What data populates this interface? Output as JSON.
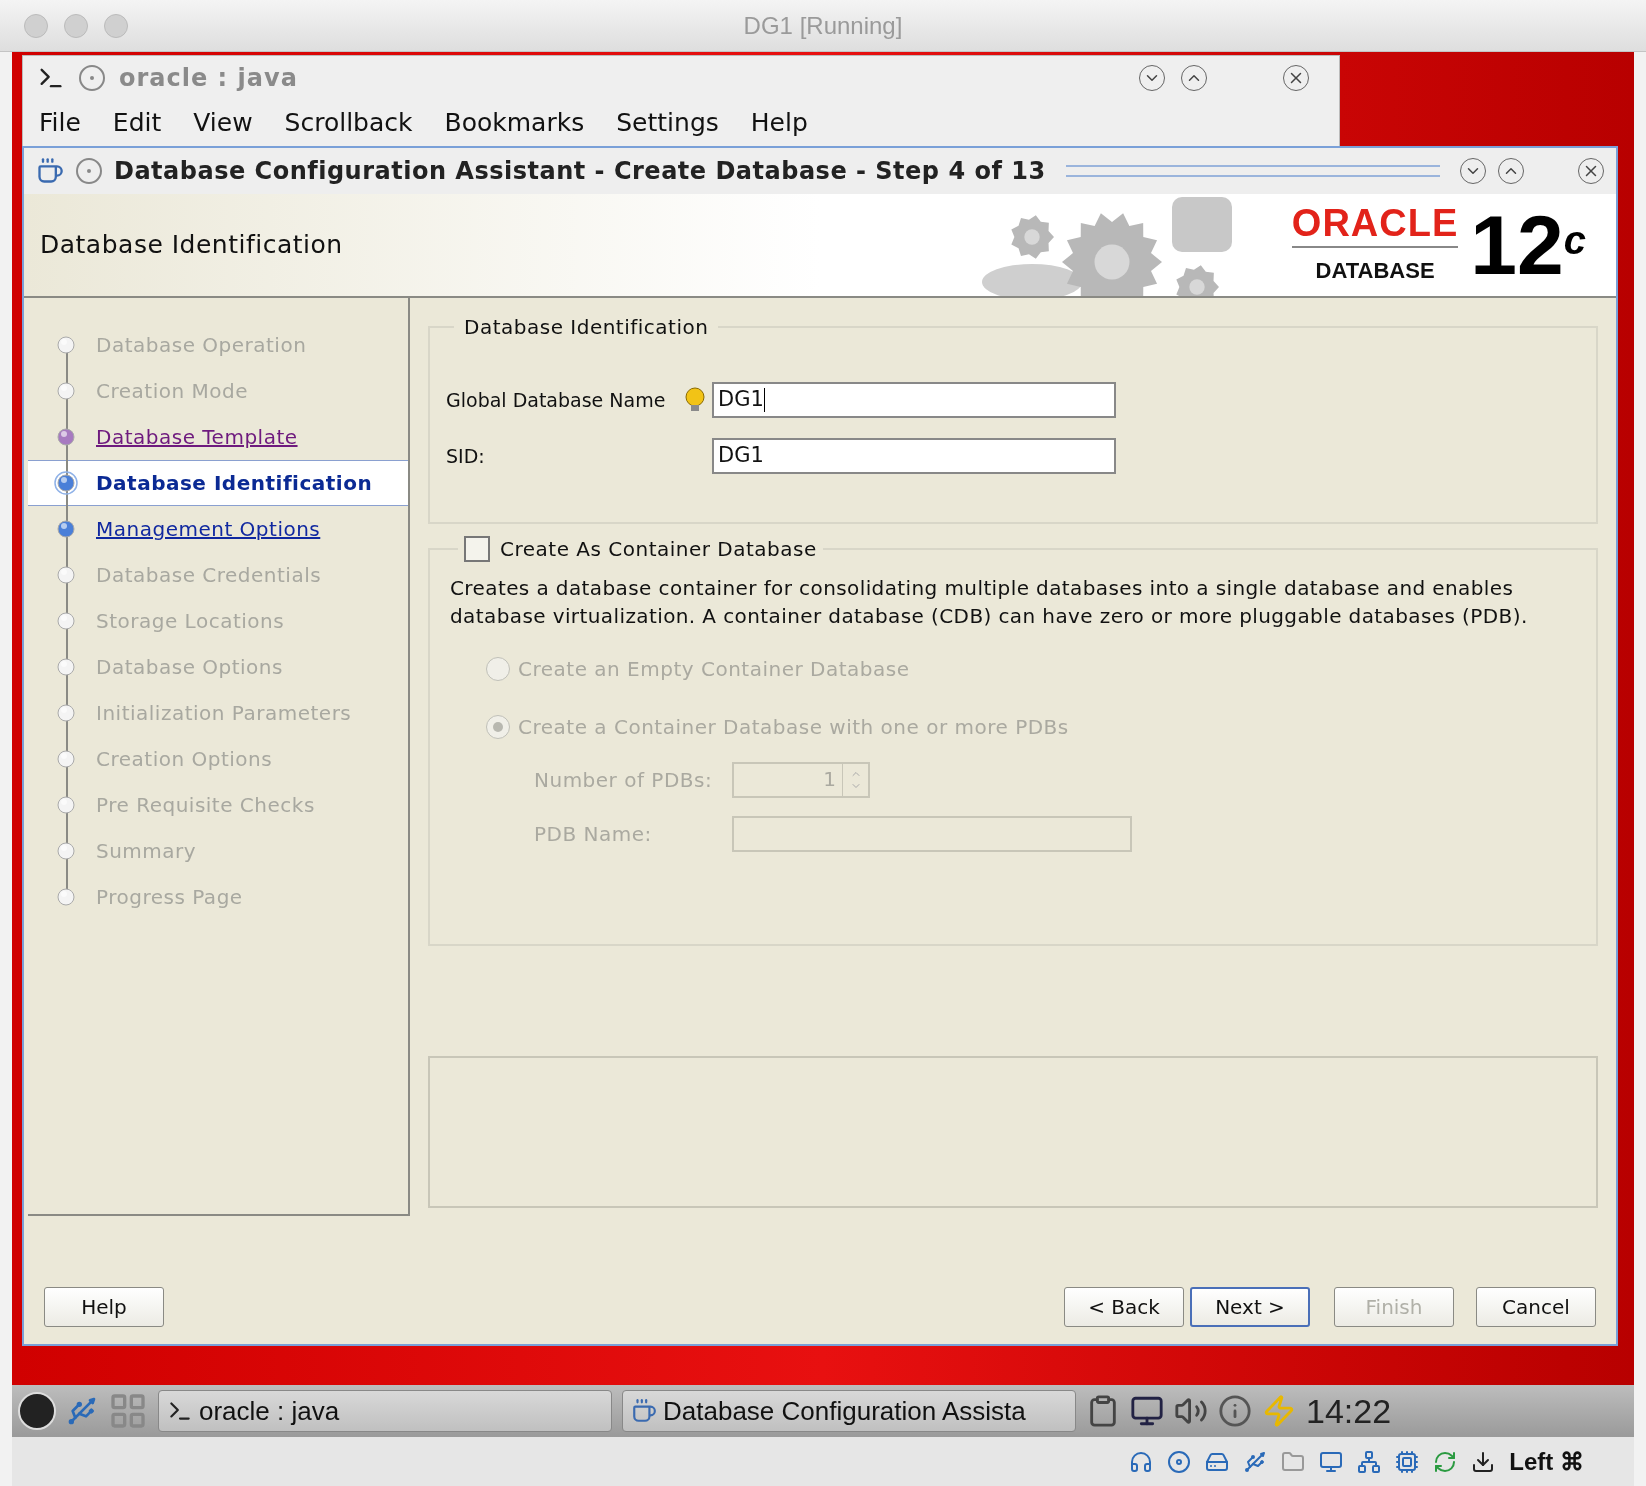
{
  "vm_window": {
    "title": "DG1 [Running]"
  },
  "terminal": {
    "title": "oracle : java",
    "menu": [
      "File",
      "Edit",
      "View",
      "Scrollback",
      "Bookmarks",
      "Settings",
      "Help"
    ]
  },
  "dialog": {
    "title": "Database Configuration Assistant - Create Database - Step 4 of 13",
    "page_title": "Database Identification",
    "logo": {
      "brand": "ORACLE",
      "product": "DATABASE",
      "version": "12$^{c}$"
    },
    "steps": [
      {
        "label": "Database Operation",
        "kind": "disabled",
        "selected": false
      },
      {
        "label": "Creation Mode",
        "kind": "disabled",
        "selected": false
      },
      {
        "label": "Database Template",
        "kind": "visited",
        "selected": false
      },
      {
        "label": "Database Identification",
        "kind": "link",
        "selected": true
      },
      {
        "label": "Management Options",
        "kind": "link",
        "selected": false
      },
      {
        "label": "Database Credentials",
        "kind": "disabled",
        "selected": false
      },
      {
        "label": "Storage Locations",
        "kind": "disabled",
        "selected": false
      },
      {
        "label": "Database Options",
        "kind": "disabled",
        "selected": false
      },
      {
        "label": "Initialization Parameters",
        "kind": "disabled",
        "selected": false
      },
      {
        "label": "Creation Options",
        "kind": "disabled",
        "selected": false
      },
      {
        "label": "Pre Requisite Checks",
        "kind": "disabled",
        "selected": false
      },
      {
        "label": "Summary",
        "kind": "disabled",
        "selected": false
      },
      {
        "label": "Progress Page",
        "kind": "disabled",
        "selected": false
      }
    ],
    "identification": {
      "legend": "Database Identification",
      "fields": [
        {
          "label": "Global Database Name",
          "value": "DG1",
          "hint": true
        },
        {
          "label": "SID:",
          "value": "DG1"
        }
      ]
    },
    "container": {
      "label": "Create As Container Database",
      "checked": false,
      "description": "Creates a database container for consolidating multiple databases into a single database and enables database virtualization. A container database (CDB) can have zero or more pluggable databases (PDB).",
      "options": [
        {
          "label": "Create an Empty Container Database",
          "selected": false,
          "disabled": true
        },
        {
          "label": "Create a Container Database with one or more PDBs",
          "selected": true,
          "disabled": true
        }
      ],
      "pdb_count": {
        "label": "Number of PDBs:",
        "value": "1",
        "disabled": true
      },
      "pdb_name": {
        "label": "PDB Name:",
        "disabled": true
      }
    },
    "buttons": [
      {
        "label": "Help",
        "disabled": false,
        "default": false
      },
      {
        "label": "< Back",
        "disabled": false,
        "default": false
      },
      {
        "label": "Next >",
        "disabled": false,
        "default": true
      },
      {
        "label": "Finish",
        "disabled": true,
        "default": false
      },
      {
        "label": "Cancel",
        "disabled": false,
        "default": false
      }
    ]
  },
  "taskbar": {
    "tasks": [
      {
        "label": "oracle : java",
        "kind": "terminal"
      },
      {
        "label": "Database Configuration Assista",
        "kind": "java"
      }
    ],
    "clock": "14:22"
  },
  "status_bar": {
    "host_key": "Left ⌘"
  }
}
